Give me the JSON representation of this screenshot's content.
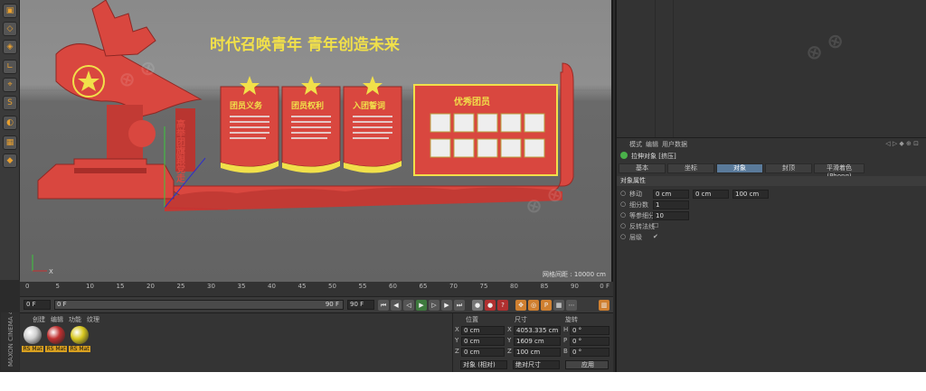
{
  "scene": {
    "headline": "时代召唤青年 青年创造未来",
    "side_label": "高举团旗跟党走",
    "panels": [
      {
        "title": "团员义务"
      },
      {
        "title": "团员权利"
      },
      {
        "title": "入团誓词"
      }
    ],
    "board_title": "优秀团员",
    "grid_info": "网格间距 : 10000 cm",
    "axis_label": "X"
  },
  "timeline": {
    "ticks": [
      "0",
      "5",
      "10",
      "15",
      "20",
      "25",
      "30",
      "35",
      "40",
      "45",
      "50",
      "55",
      "60",
      "65",
      "70",
      "75",
      "80",
      "85",
      "90"
    ],
    "end_label": "0 F"
  },
  "transport": {
    "start_frame": "0 F",
    "slider_start": "0 F",
    "slider_end": "90 F",
    "end_frame": "90 F"
  },
  "material_manager": {
    "menu": [
      "创建",
      "编辑",
      "功能",
      "纹理"
    ],
    "materials": [
      {
        "label": "RS Mat",
        "color": "#cfcfcf"
      },
      {
        "label": "RS Mat",
        "color": "#c03030"
      },
      {
        "label": "RS Mat",
        "color": "#d8c820"
      }
    ]
  },
  "coordinates": {
    "headers": [
      "位置",
      "尺寸",
      "旋转"
    ],
    "rows": [
      {
        "axis": "X",
        "pos": "0 cm",
        "size_axis": "X",
        "size": "4053.335 cm",
        "rot_axis": "H",
        "rot": "0 °"
      },
      {
        "axis": "Y",
        "pos": "0 cm",
        "size_axis": "Y",
        "size": "1609 cm",
        "rot_axis": "P",
        "rot": "0 °"
      },
      {
        "axis": "Z",
        "pos": "0 cm",
        "size_axis": "Z",
        "size": "100 cm",
        "rot_axis": "B",
        "rot": "0 °"
      }
    ],
    "mode_select": "对象 (相对)",
    "size_select": "绝对尺寸",
    "apply_button": "应用"
  },
  "attribute_manager": {
    "menu": [
      "模式",
      "编辑",
      "用户数据"
    ],
    "object_title": "拉伸对象 [挤压]",
    "tabs": [
      "基本",
      "坐标",
      "对象",
      "封顶",
      "平滑着色(Phong)"
    ],
    "section": "对象属性",
    "props": [
      {
        "label": "移动",
        "values": [
          "0 cm",
          "0 cm",
          "100 cm"
        ]
      },
      {
        "label": "细分数",
        "values": [
          "1"
        ]
      },
      {
        "label": "等参细分",
        "values": [
          "10"
        ]
      },
      {
        "label": "反转法线",
        "values": []
      },
      {
        "label": "层级",
        "values": []
      }
    ],
    "checkmark": "✔"
  },
  "colors": {
    "accent": "#e8a030",
    "active_tab": "#5a7a9a",
    "display_red": "#d9473f",
    "display_yellow": "#f1e04a"
  }
}
